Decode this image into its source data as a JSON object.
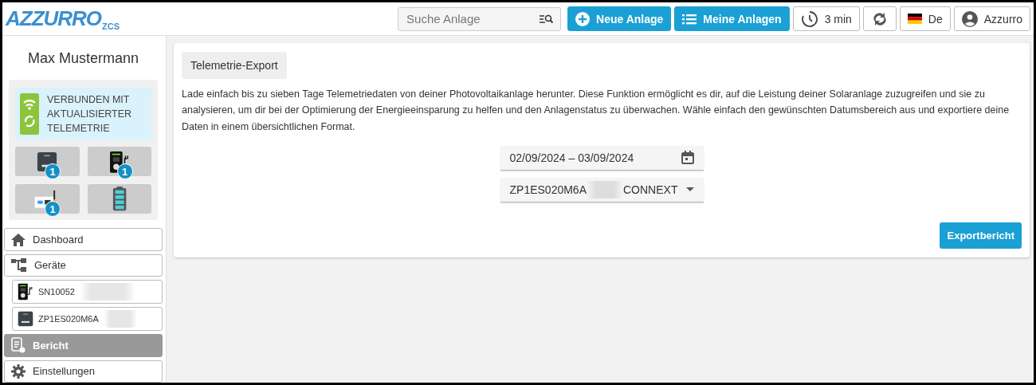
{
  "logo": {
    "name": "AZZURRO",
    "sub": "ZCS"
  },
  "header": {
    "search": {
      "placeholder": "Suche Anlage"
    },
    "buttons": [
      {
        "kind": "primary",
        "label": "Neue Anlage"
      },
      {
        "kind": "primary",
        "label": "Meine Anlagen"
      },
      {
        "kind": "plain",
        "label": "3 min"
      },
      {
        "kind": "plain"
      },
      {
        "kind": "plain",
        "label": "De"
      },
      {
        "kind": "plain",
        "label": "Azzurro"
      }
    ]
  },
  "sidebar": {
    "user": "Max Mustermann",
    "status": {
      "connected": true,
      "text": "VERBUNDEN MIT AKTUALISIERTER TELEMETRIE"
    },
    "devices": [
      {
        "kind": "inverter",
        "badge": "1"
      },
      {
        "kind": "charger",
        "badge": "1"
      },
      {
        "kind": "datalogger",
        "badge": "1"
      },
      {
        "kind": "battery"
      }
    ],
    "items": [
      {
        "kind": "main",
        "label": "Dashboard",
        "selected": false
      },
      {
        "kind": "main",
        "label": "Geräte",
        "selected": false
      },
      {
        "kind": "sub",
        "label": "SN10052",
        "redacted": true,
        "selected": false
      },
      {
        "kind": "sub",
        "label": "ZP1ES020M6A",
        "redacted": true,
        "selected": false
      },
      {
        "kind": "main",
        "label": "Bericht",
        "selected": true
      },
      {
        "kind": "main",
        "label": "Einstellungen",
        "selected": false
      }
    ]
  },
  "export": {
    "title": "Telemetrie-Export",
    "description": "Lade einfach bis zu sieben Tage Telemetriedaten von deiner Photovoltaikanlage herunter. Diese Funktion ermöglicht es dir, auf die Leistung deiner Solaranlage zuzugreifen und sie zu analysieren, um dir bei der Optimierung der Energieeinsparung zu helfen und den Anlagenstatus zu überwachen. Wähle einfach den gewünschten Datumsbereich aus und exportiere deine Daten in einem übersichtlichen Format.",
    "date_range": "02/09/2024 – 03/09/2024",
    "device_select": {
      "value_start": "ZP1ES020M6A",
      "value_end": "CONNEXT"
    },
    "button": "Exportbericht"
  }
}
